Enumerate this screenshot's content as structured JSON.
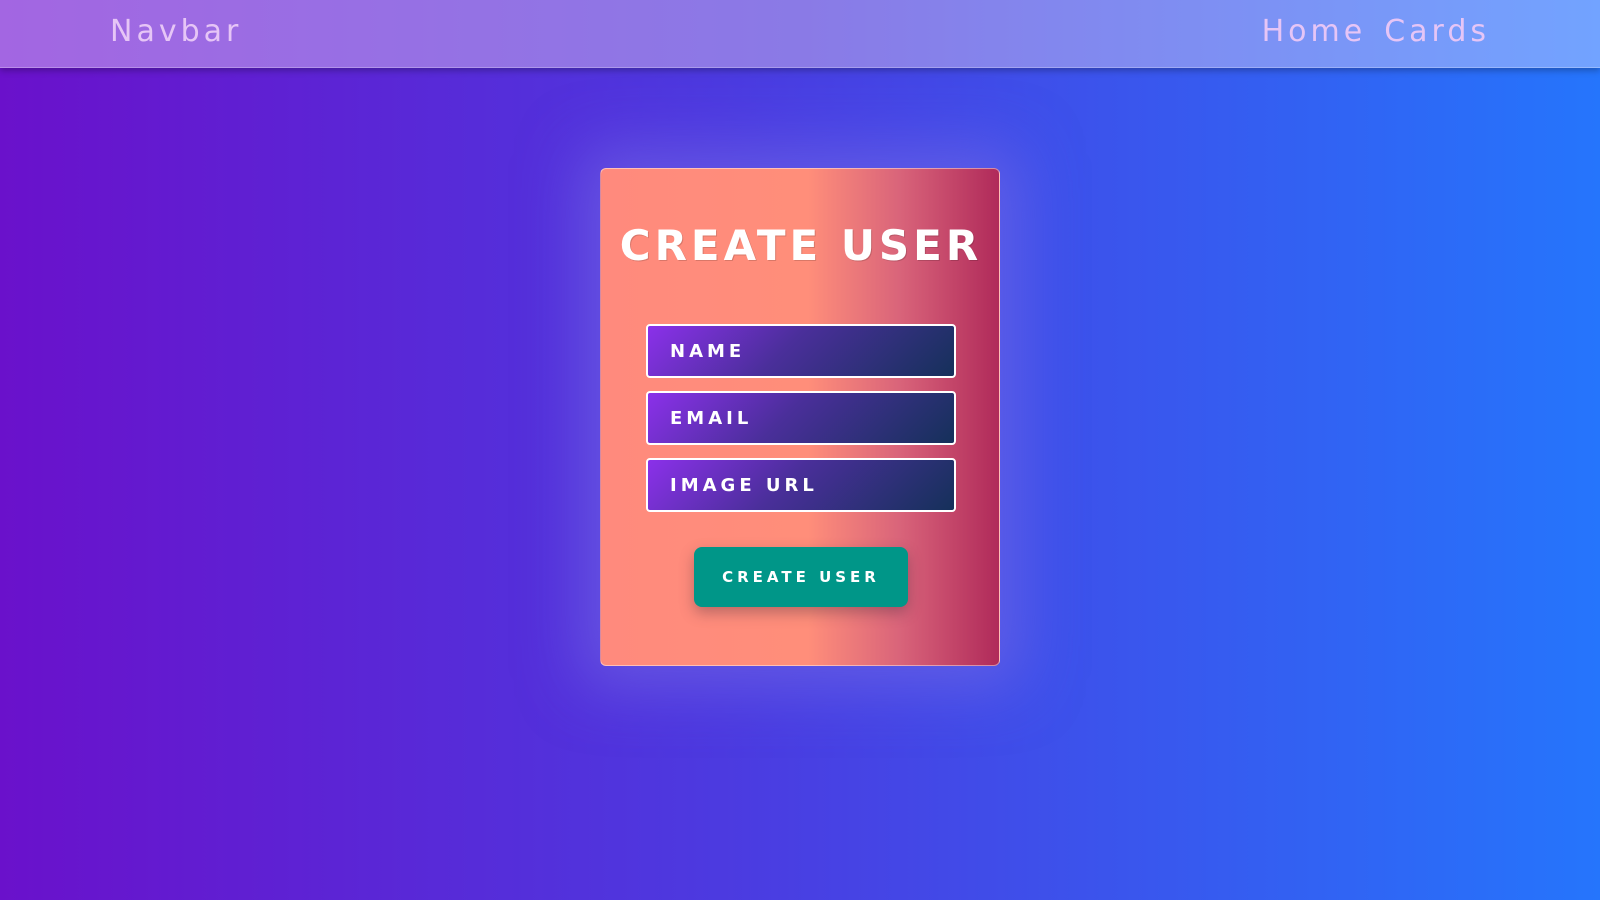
{
  "navbar": {
    "brand": "Navbar",
    "links": [
      "Home",
      "Cards"
    ]
  },
  "form": {
    "title": "CREATE USER",
    "fields": [
      {
        "placeholder": "NAME",
        "value": ""
      },
      {
        "placeholder": "EMAIL",
        "value": ""
      },
      {
        "placeholder": "IMAGE URL",
        "value": ""
      }
    ],
    "submit_label": "CREATE USER"
  },
  "colors": {
    "background_start": "#6a11cb",
    "background_end": "#2575fc",
    "button": "#009688",
    "card_start": "#ff8a7d",
    "card_end": "#b02a5a"
  }
}
